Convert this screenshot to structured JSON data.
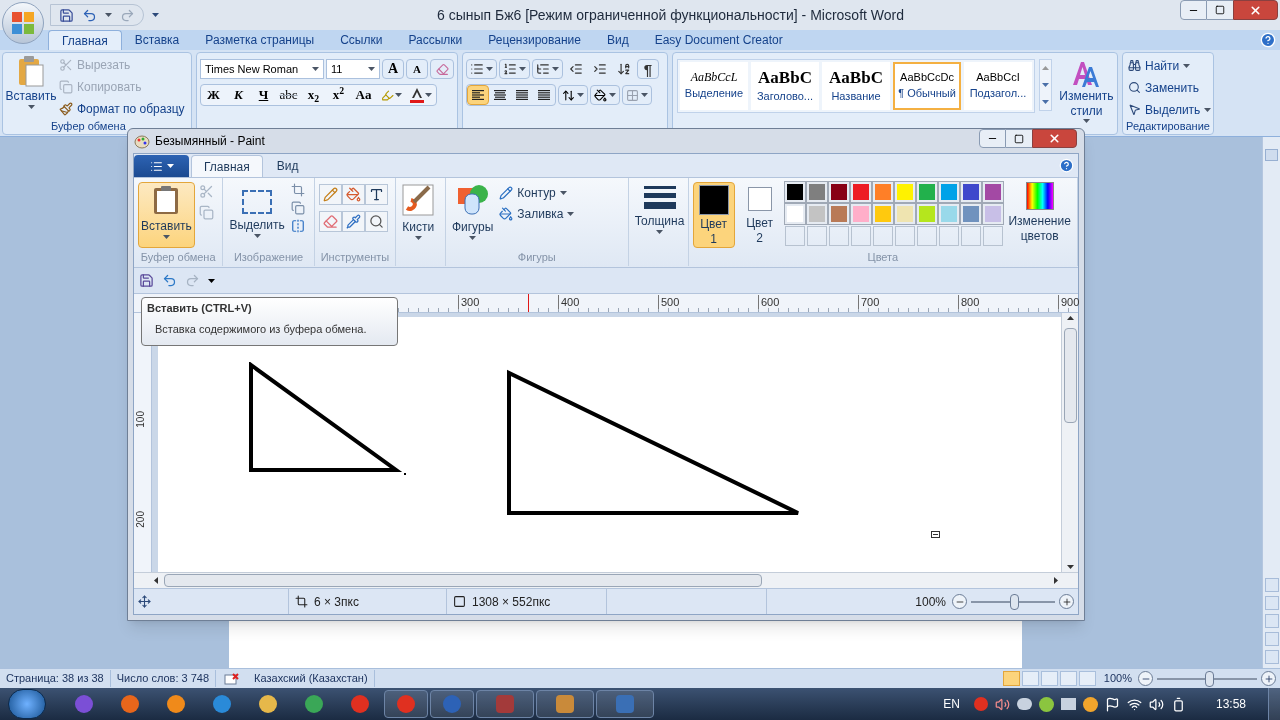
{
  "word": {
    "title": "6 сынып Бж6 [Режим ограниченной функциональности] - Microsoft Word",
    "tabs": [
      {
        "label": "Главная",
        "selected": true
      },
      {
        "label": "Вставка",
        "selected": false
      },
      {
        "label": "Разметка страницы",
        "selected": false
      },
      {
        "label": "Ссылки",
        "selected": false
      },
      {
        "label": "Рассылки",
        "selected": false
      },
      {
        "label": "Рецензирование",
        "selected": false
      },
      {
        "label": "Вид",
        "selected": false
      },
      {
        "label": "Easy Document Creator",
        "selected": false
      }
    ],
    "clipboard": {
      "paste": "Вставить",
      "cut": {
        "label": "Вырезать",
        "disabled": true
      },
      "copy": {
        "label": "Копировать",
        "disabled": true
      },
      "format_painter": {
        "label": "Формат по образцу",
        "disabled": false
      },
      "group_label": "Буфер обмена"
    },
    "font": {
      "name": "Times New Roman",
      "size": "11",
      "grow": "A",
      "shrink": "A",
      "format_buttons": [
        {
          "label": "Ж",
          "kind": "bold"
        },
        {
          "label": "К",
          "kind": "italic"
        },
        {
          "label": "Ч",
          "kind": "underline"
        },
        {
          "label": "abc",
          "kind": "strike"
        },
        {
          "label": "x$_{2}$",
          "kind": "plain"
        },
        {
          "label": "x$^{2}$",
          "kind": "plain"
        },
        {
          "label": "Aa",
          "kind": "plain"
        }
      ]
    },
    "paragraph": {
      "pilcrow": "¶",
      "alignments": [
        {
          "selected": true
        },
        {
          "selected": false
        },
        {
          "selected": false
        },
        {
          "selected": false
        }
      ]
    },
    "styles": [
      {
        "sample": "AaBbCcL",
        "label": "Выделение",
        "kind": "emphasis",
        "selected": false
      },
      {
        "sample": "AaBbC",
        "label": "Заголово...",
        "kind": "heading",
        "selected": false
      },
      {
        "sample": "AaBbC",
        "label": "Название",
        "kind": "title",
        "selected": false
      },
      {
        "sample": "AaBbCcDc",
        "label": "¶ Обычный",
        "kind": "normal",
        "selected": true
      },
      {
        "sample": "AaBbCcI",
        "label": "Подзагол...",
        "kind": "subtitle",
        "selected": false
      }
    ],
    "change_styles": "Изменить стили",
    "editing": {
      "items": [
        {
          "label": "Найти",
          "dropdown": true
        },
        {
          "label": "Заменить",
          "dropdown": false
        },
        {
          "label": "Выделить",
          "dropdown": true
        }
      ],
      "group_label": "Редактирование"
    },
    "status_bar": {
      "page": "Страница: 38 из 38",
      "words": "Число слов: 3 748",
      "language": "Казахский (Казахстан)",
      "zoom": "100%",
      "zoom_slider": {
        "level": 0.52
      }
    }
  },
  "paint": {
    "title": "Безымянный - Paint",
    "tabs": [
      {
        "label": "Главная",
        "selected": true
      },
      {
        "label": "Вид",
        "selected": false
      }
    ],
    "clipboard": {
      "paste": {
        "label": "Вставить",
        "highlighted": true
      },
      "group_label": "Буфер обмена"
    },
    "image": {
      "select": "Выделить",
      "group_label": "Изображение"
    },
    "tools": {
      "group_label": "Инструменты"
    },
    "brushes": "Кисти",
    "shapes": {
      "label": "Фигуры",
      "outline": "Контур",
      "fill": "Заливка",
      "group_label": "Фигуры"
    },
    "size": "Толщина",
    "colors": {
      "primary": {
        "label": "Цвет 1",
        "color": "#000000",
        "selected": true
      },
      "secondary": {
        "label": "Цвет 2",
        "color": "#ffffff",
        "selected": false
      },
      "palette": [
        {
          "color": "#000000"
        },
        {
          "color": "#7f7f7f"
        },
        {
          "color": "#880015"
        },
        {
          "color": "#ed1c24"
        },
        {
          "color": "#ff7f27"
        },
        {
          "color": "#fff200"
        },
        {
          "color": "#22b14c"
        },
        {
          "color": "#00a2e8"
        },
        {
          "color": "#3f48cc"
        },
        {
          "color": "#a349a4"
        },
        {
          "color": "#ffffff"
        },
        {
          "color": "#c3c3c3"
        },
        {
          "color": "#b97a57"
        },
        {
          "color": "#ffaec9"
        },
        {
          "color": "#ffc90e"
        },
        {
          "color": "#efe4b0"
        },
        {
          "color": "#b5e61d"
        },
        {
          "color": "#99d9ea"
        },
        {
          "color": "#7092be"
        },
        {
          "color": "#c8bfe7"
        }
      ],
      "edit": "Изменение цветов",
      "group_label": "Цвета"
    },
    "tooltip": {
      "title": "Вставить (CTRL+V)",
      "text": "Вставка содержимого из буфера обмена."
    },
    "ruler": {
      "horizontal": [
        "300",
        "400",
        "500",
        "600",
        "700",
        "800",
        "900"
      ],
      "vertical": [
        "100",
        "200"
      ]
    },
    "status_bar": {
      "selection": "6 × 3пкс",
      "image_size": "1308 × 552пкс",
      "zoom": "100%",
      "zoom_slider": {
        "level": 0.51
      }
    }
  },
  "taskbar": {
    "language": "EN",
    "time": "13:58"
  }
}
